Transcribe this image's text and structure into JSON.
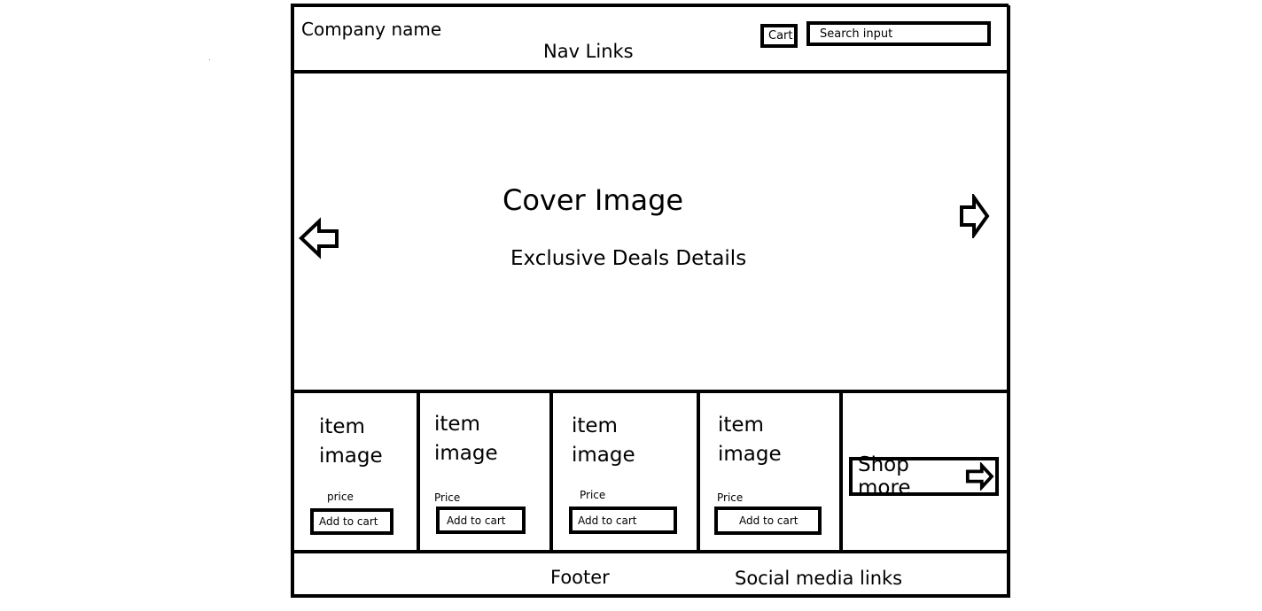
{
  "header": {
    "company_name": "Company name",
    "nav_links": "Nav Links",
    "cart_label": "Cart",
    "search_placeholder": "Search input"
  },
  "hero": {
    "title": "Cover Image",
    "subtitle": "Exclusive Deals Details",
    "prev_icon": "left-arrow-icon",
    "next_icon": "right-arrow-icon"
  },
  "products": {
    "items": [
      {
        "image_label_1": "item",
        "image_label_2": "image",
        "price": "price",
        "add_to_cart": "Add to cart"
      },
      {
        "image_label_1": "item",
        "image_label_2": "image",
        "price": "Price",
        "add_to_cart": "Add to cart"
      },
      {
        "image_label_1": "item",
        "image_label_2": "image",
        "price": "Price",
        "add_to_cart": "Add to cart"
      },
      {
        "image_label_1": "item",
        "image_label_2": "image",
        "price": "Price",
        "add_to_cart": "Add to cart"
      }
    ],
    "shop_more": "Shop more"
  },
  "footer": {
    "label": "Footer",
    "social": "Social media links"
  }
}
